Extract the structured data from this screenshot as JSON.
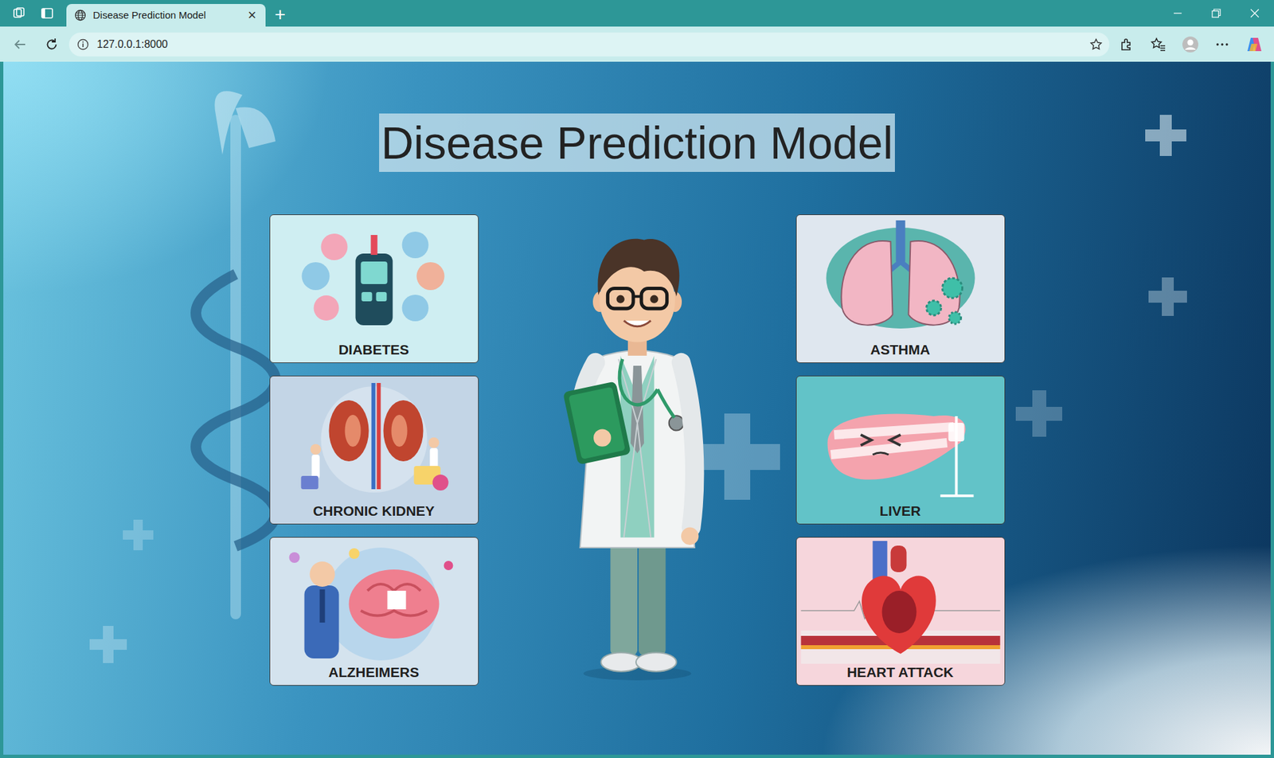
{
  "tab": {
    "title": "Disease Prediction Model",
    "close": "×",
    "selected": true
  },
  "new_tab": "+",
  "address_bar": {
    "url": "127.0.0.1:8000"
  },
  "page": {
    "title": "Disease Prediction Model",
    "left_cards": [
      {
        "label": "DIABETES",
        "kind": "diabetes"
      },
      {
        "label": "CHRONIC KIDNEY",
        "kind": "kidney"
      },
      {
        "label": "ALZHEIMERS",
        "kind": "alzheimers"
      }
    ],
    "right_cards": [
      {
        "label": "ASTHMA",
        "kind": "asthma"
      },
      {
        "label": "LIVER",
        "kind": "liver"
      },
      {
        "label": "HEART ATTACK",
        "kind": "heart"
      }
    ]
  }
}
